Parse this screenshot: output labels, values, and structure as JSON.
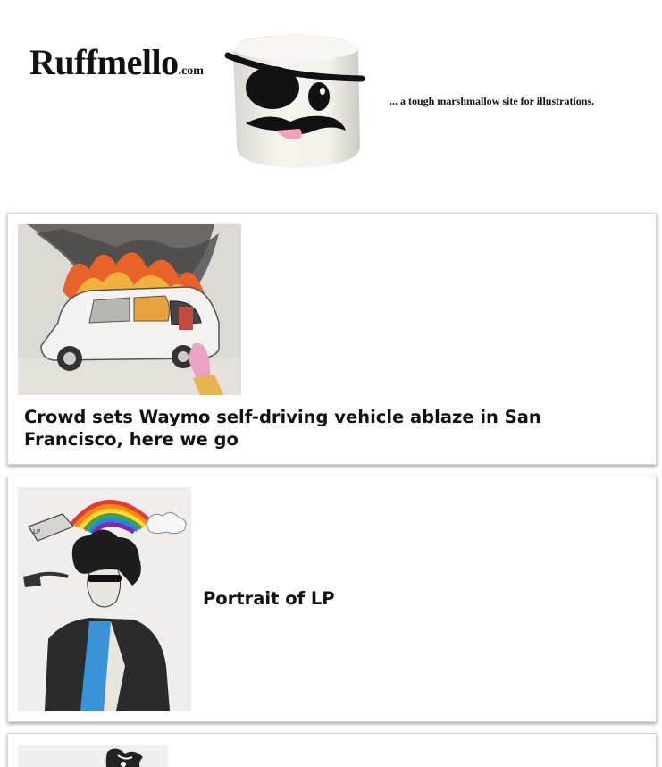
{
  "site": {
    "logo_main": "Ruffmello",
    "logo_tld": ".com",
    "tagline": "... a tough marshmallow site for illustrations."
  },
  "posts": [
    {
      "title": "Crowd sets Waymo self-driving vehicle ablaze in San Francisco, here we go",
      "thumbnail": "burning-car-illustration"
    },
    {
      "title": "Portrait of LP",
      "thumbnail": "lp-portrait-illustration"
    },
    {
      "title": "",
      "thumbnail": "partial-illustration"
    }
  ]
}
